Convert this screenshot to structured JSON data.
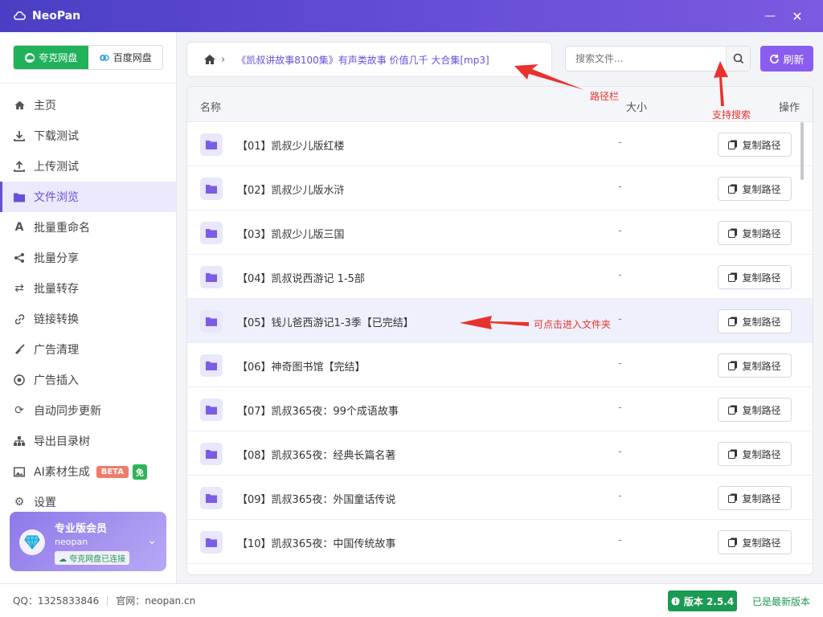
{
  "app": {
    "title": "NeoPan"
  },
  "window": {
    "minimize_glyph": "—",
    "close_glyph": "✕"
  },
  "drive_switch": {
    "quark_label": "夸克网盘",
    "baidu_label": "百度网盘"
  },
  "nav": [
    {
      "label": "主页",
      "icon": "home-icon"
    },
    {
      "label": "下载测试",
      "icon": "download-icon"
    },
    {
      "label": "上传测试",
      "icon": "upload-icon"
    },
    {
      "label": "文件浏览",
      "icon": "folder-icon",
      "active": true
    },
    {
      "label": "批量重命名",
      "icon": "font-icon"
    },
    {
      "label": "批量分享",
      "icon": "share-icon"
    },
    {
      "label": "批量转存",
      "icon": "transfer-icon"
    },
    {
      "label": "链接转换",
      "icon": "link-icon"
    },
    {
      "label": "广告清理",
      "icon": "broom-icon"
    },
    {
      "label": "广告插入",
      "icon": "target-icon"
    },
    {
      "label": "自动同步更新",
      "icon": "sync-icon"
    },
    {
      "label": "导出目录树",
      "icon": "tree-icon"
    },
    {
      "label": "AI素材生成",
      "icon": "image-icon",
      "badge_beta": "BETA",
      "badge_free": "免"
    },
    {
      "label": "设置",
      "icon": "settings-icon"
    }
  ],
  "member": {
    "title": "专业版会员",
    "user": "neopan",
    "status": "夸克网盘已连接"
  },
  "statusbar": {
    "qq": "QQ：1325833846",
    "site": "官网：neopan.cn",
    "version": "版本 2.5.4",
    "latest": "已是最新版本"
  },
  "path": {
    "text": "《凯叔讲故事8100集》有声类故事 价值几千 大合集[mp3]"
  },
  "search": {
    "placeholder": "搜索文件..."
  },
  "refresh_label": "刷新",
  "table": {
    "col_name": "名称",
    "col_size": "大小",
    "col_action": "操作",
    "copy_label": "复制路径",
    "rows": [
      {
        "name": "【01】凯叔少儿版红楼",
        "size": "-"
      },
      {
        "name": "【02】凯叔少儿版水浒",
        "size": "-"
      },
      {
        "name": "【03】凯叔少儿版三国",
        "size": "-"
      },
      {
        "name": "【04】凯叔说西游记 1-5部",
        "size": "-"
      },
      {
        "name": "【05】钱儿爸西游记1-3季【已完结】",
        "size": "-"
      },
      {
        "name": "【06】神奇图书馆【完结】",
        "size": "-"
      },
      {
        "name": "【07】凯叔365夜：99个成语故事",
        "size": "-"
      },
      {
        "name": "【08】凯叔365夜：经典长篇名著",
        "size": "-"
      },
      {
        "name": "【09】凯叔365夜：外国童话传说",
        "size": "-"
      },
      {
        "name": "【10】凯叔365夜：中国传统故事",
        "size": "-"
      }
    ]
  },
  "annotations": {
    "path": "路径栏",
    "search": "支持搜索",
    "folder": "可点击进入文件夹"
  },
  "colors": {
    "accent": "#6a4fd8",
    "brand_green": "#1fb25a",
    "annotation_red": "#e8322e"
  }
}
